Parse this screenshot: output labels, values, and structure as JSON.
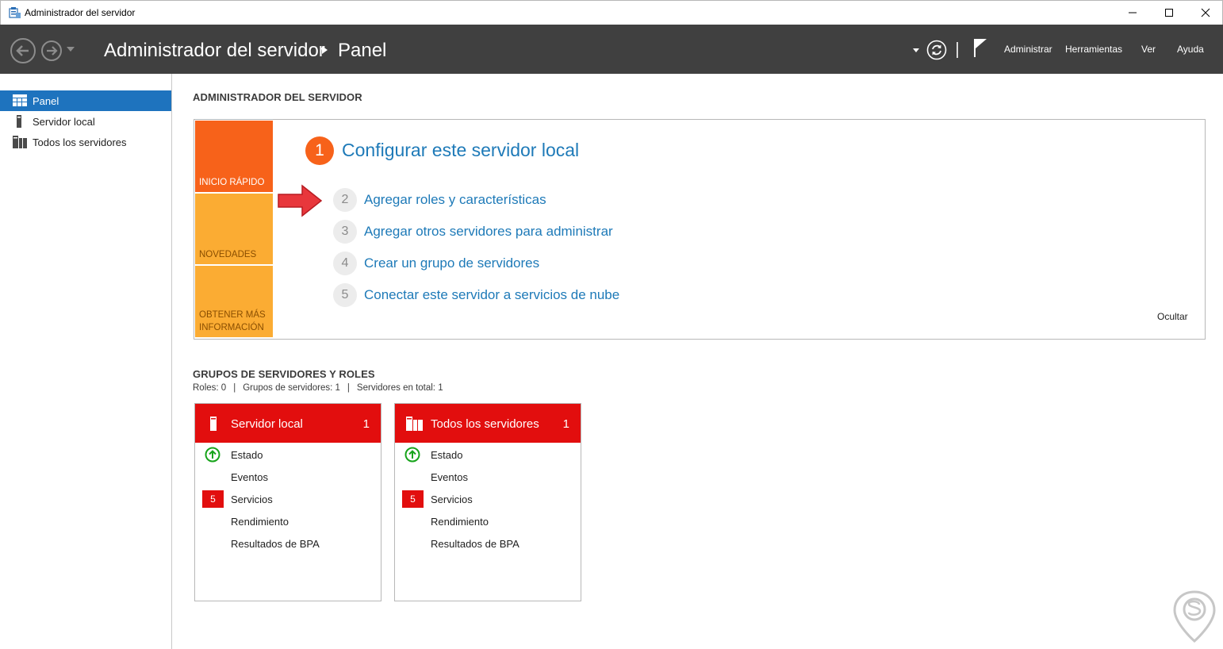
{
  "window": {
    "title": "Administrador del servidor",
    "minimize_icon": "minimize-icon",
    "maximize_icon": "maximize-icon",
    "close_icon": "close-icon"
  },
  "header": {
    "breadcrumb_root": "Administrador del servidor",
    "breadcrumb_current": "Panel",
    "menu": [
      "Administrar",
      "Herramientas",
      "Ver",
      "Ayuda"
    ],
    "background": "#404040"
  },
  "sidebar": {
    "items": [
      {
        "label": "Panel",
        "icon": "dashboard-icon",
        "active": true
      },
      {
        "label": "Servidor local",
        "icon": "server-icon",
        "active": false
      },
      {
        "label": "Todos los servidores",
        "icon": "servers-icon",
        "active": false
      }
    ],
    "active_color": "#1e73be"
  },
  "welcome": {
    "section_title": "ADMINISTRADOR DEL SERVIDOR",
    "tiles": [
      "INICIO RÁPIDO",
      "NOVEDADES",
      "OBTENER MÁS INFORMACIÓN"
    ],
    "tile_line2": "INFORMACIÓN",
    "tile_line1": "OBTENER MÁS",
    "step1": {
      "number": "1",
      "label": "Configurar este servidor local"
    },
    "steps": [
      {
        "number": "2",
        "label": "Agregar roles y características"
      },
      {
        "number": "3",
        "label": "Agregar otros servidores para administrar"
      },
      {
        "number": "4",
        "label": "Crear un grupo de servidores"
      },
      {
        "number": "5",
        "label": "Conectar este servidor a servicios de nube"
      }
    ],
    "hide_label": "Ocultar",
    "accent_orange": "#f7621a",
    "tile_yellow": "#fbac33",
    "link_color": "#1e7ab8"
  },
  "groups": {
    "section_title": "GRUPOS DE SERVIDORES Y ROLES",
    "stats": [
      "Roles: 0",
      "Grupos de servidores: 1",
      "Servidores en total: 1"
    ],
    "stat_separator": "|",
    "cards": [
      {
        "title": "Servidor local",
        "count": "1",
        "icon": "server-icon",
        "rows": [
          {
            "label": "Estado",
            "badge": "status-up-icon"
          },
          {
            "label": "Eventos",
            "badge": ""
          },
          {
            "label": "Servicios",
            "badge": "5"
          },
          {
            "label": "Rendimiento",
            "badge": ""
          },
          {
            "label": "Resultados de BPA",
            "badge": ""
          }
        ]
      },
      {
        "title": "Todos los servidores",
        "count": "1",
        "icon": "servers-icon",
        "rows": [
          {
            "label": "Estado",
            "badge": "status-up-icon"
          },
          {
            "label": "Eventos",
            "badge": ""
          },
          {
            "label": "Servicios",
            "badge": "5"
          },
          {
            "label": "Rendimiento",
            "badge": ""
          },
          {
            "label": "Resultados de BPA",
            "badge": ""
          }
        ]
      }
    ],
    "header_red": "#e20e0e"
  }
}
